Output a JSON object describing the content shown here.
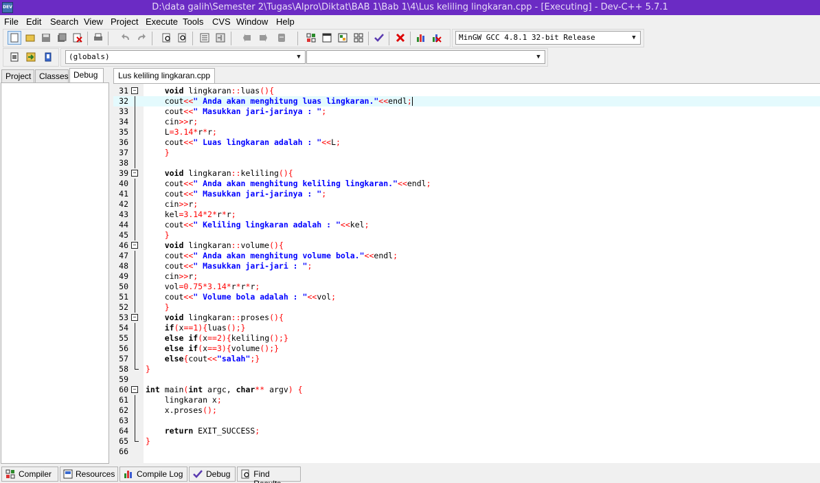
{
  "window": {
    "title": "D:\\data galih\\Semester 2\\Tugas\\Alpro\\Diktat\\BAB 1\\Bab 1\\4\\Lus keliling lingkaran.cpp - [Executing] - Dev-C++ 5.7.1",
    "app_icon_label": "DEV"
  },
  "menu": [
    "File",
    "Edit",
    "Search",
    "View",
    "Project",
    "Execute",
    "Tools",
    "CVS",
    "Window",
    "Help"
  ],
  "toolbar": {
    "compiler_select": "MinGW GCC 4.8.1 32-bit Release",
    "globals_select": "(globals)",
    "members_select": ""
  },
  "left_tabs": [
    "Project",
    "Classes",
    "Debug"
  ],
  "active_left_tab": "Debug",
  "file_tab": "Lus keliling lingkaran.cpp",
  "code": [
    {
      "n": "31",
      "t": "    void lingkaran::luas(){"
    },
    {
      "n": "32",
      "t": "    cout<<\" Anda akan menghitung luas lingkaran.\"<<endl;"
    },
    {
      "n": "33",
      "t": "    cout<<\" Masukkan jari-jarinya : \";"
    },
    {
      "n": "34",
      "t": "    cin>>r;"
    },
    {
      "n": "35",
      "t": "    L=3.14*r*r;"
    },
    {
      "n": "36",
      "t": "    cout<<\" Luas lingkaran adalah : \"<<L;"
    },
    {
      "n": "37",
      "t": "    }"
    },
    {
      "n": "38",
      "t": ""
    },
    {
      "n": "39",
      "t": "    void lingkaran::keliling(){"
    },
    {
      "n": "40",
      "t": "    cout<<\" Anda akan menghitung keliling lingkaran.\"<<endl;"
    },
    {
      "n": "41",
      "t": "    cout<<\" Masukkan jari-jarinya : \";"
    },
    {
      "n": "42",
      "t": "    cin>>r;"
    },
    {
      "n": "43",
      "t": "    kel=3.14*2*r*r;"
    },
    {
      "n": "44",
      "t": "    cout<<\" Keliling lingkaran adalah : \"<<kel;"
    },
    {
      "n": "45",
      "t": "    }"
    },
    {
      "n": "46",
      "t": "    void lingkaran::volume(){"
    },
    {
      "n": "47",
      "t": "    cout<<\" Anda akan menghitung volume bola.\"<<endl;"
    },
    {
      "n": "48",
      "t": "    cout<<\" Masukkan jari-jari : \";"
    },
    {
      "n": "49",
      "t": "    cin>>r;"
    },
    {
      "n": "50",
      "t": "    vol=0.75*3.14*r*r*r;"
    },
    {
      "n": "51",
      "t": "    cout<<\" Volume bola adalah : \"<<vol;"
    },
    {
      "n": "52",
      "t": "    }"
    },
    {
      "n": "53",
      "t": "    void lingkaran::proses(){"
    },
    {
      "n": "54",
      "t": "    if(x==1){luas();}"
    },
    {
      "n": "55",
      "t": "    else if(x==2){keliling();}"
    },
    {
      "n": "56",
      "t": "    else if(x==3){volume();}"
    },
    {
      "n": "57",
      "t": "    else{cout<<\"salah\";}"
    },
    {
      "n": "58",
      "t": "}"
    },
    {
      "n": "59",
      "t": ""
    },
    {
      "n": "60",
      "t": "int main(int argc, char** argv) {"
    },
    {
      "n": "61",
      "t": "    lingkaran x;"
    },
    {
      "n": "62",
      "t": "    x.proses();"
    },
    {
      "n": "63",
      "t": ""
    },
    {
      "n": "64",
      "t": "    return EXIT_SUCCESS;"
    },
    {
      "n": "65",
      "t": "}"
    },
    {
      "n": "66",
      "t": ""
    }
  ],
  "bottom_tabs": [
    "Compiler",
    "Resources",
    "Compile Log",
    "Debug",
    "Find Results"
  ]
}
